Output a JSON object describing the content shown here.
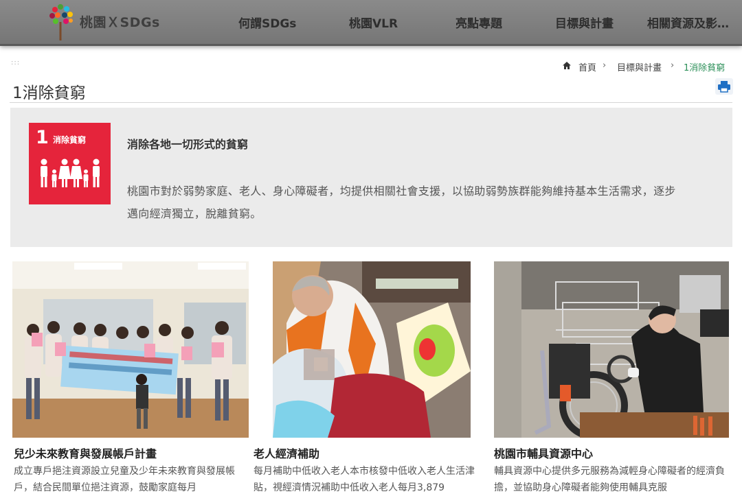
{
  "header": {
    "brand": "桃園ＸSDGs",
    "nav": [
      "何謂SDGs",
      "桃園VLR",
      "亮點專題",
      "目標與計畫",
      "相關資源及影…"
    ]
  },
  "breadcrumb": {
    "home": "首頁",
    "level2": "目標與計畫",
    "current": "1消除貧窮",
    "separator": "›"
  },
  "page": {
    "title": "1消除貧窮",
    "decorative_dots": ":::"
  },
  "goal": {
    "number": "1",
    "tile_label": "消除貧窮",
    "tile_color": "#e5243b",
    "heading": "消除各地一切形式的貧窮",
    "description": "桃園市對於弱勢家庭、老人、身心障礙者，均提供相關社會支援，以協助弱勢族群能夠維持基本生活需求，逐步邁向經濟獨立，脫離貧窮。"
  },
  "cards": [
    {
      "title": "兒少未來教育與發展帳戶計畫",
      "text": "成立專戶挹注資源設立兒童及少年未來教育與發展帳戶，結合民間單位挹注資源，鼓勵家庭每月"
    },
    {
      "title": "老人經濟補助",
      "text": "每月補助中低收入老人本市核發中低收入老人生活津貼，視經濟情況補助中低收入老人每月3,879"
    },
    {
      "title": "桃園市輔具資源中心",
      "text": "輔具資源中心提供多元服務為減輕身心障礙者的經濟負擔，並協助身心障礙者能夠使用輔具克服"
    }
  ]
}
